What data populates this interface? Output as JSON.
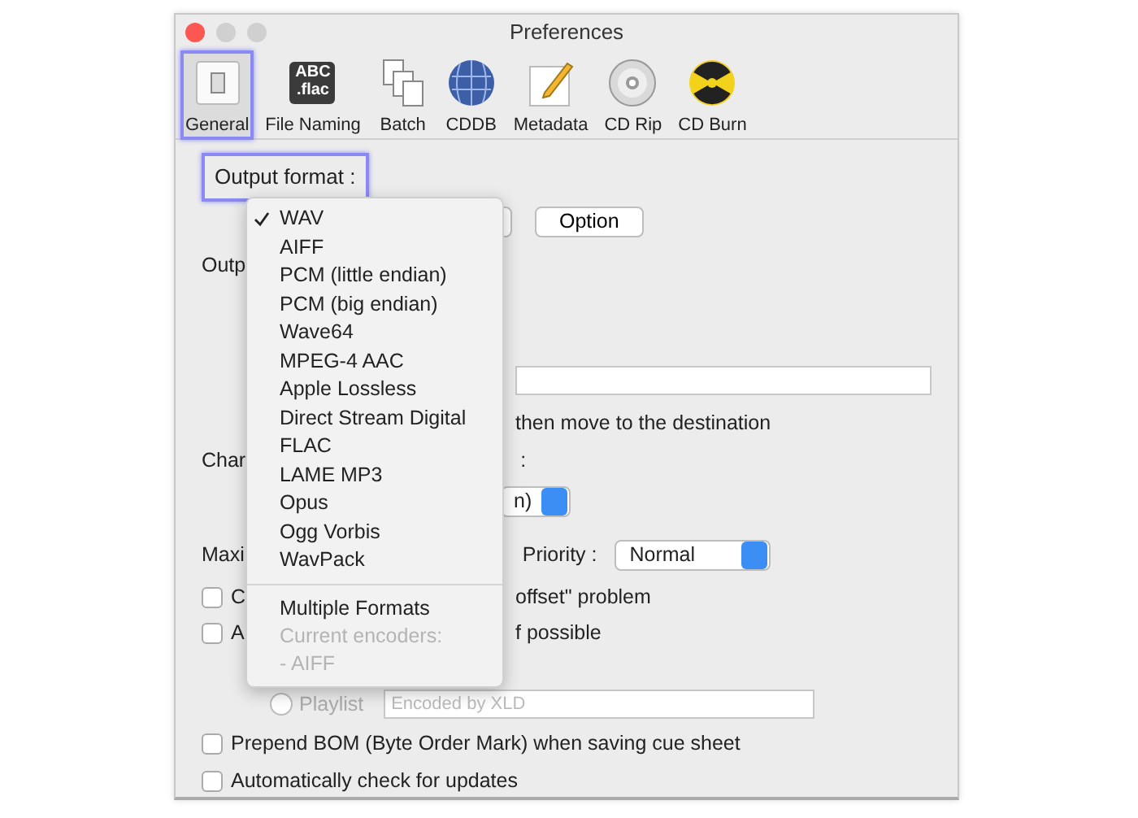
{
  "window": {
    "title": "Preferences"
  },
  "toolbar": [
    {
      "label": "General",
      "kind": "general",
      "selected": true,
      "highlighted": true
    },
    {
      "label": "File Naming",
      "kind": "file-naming",
      "selected": false,
      "highlighted": false,
      "icon_text": [
        "ABC",
        ".flac"
      ]
    },
    {
      "label": "Batch",
      "kind": "batch",
      "selected": false,
      "highlighted": false
    },
    {
      "label": "CDDB",
      "kind": "cddb",
      "selected": false,
      "highlighted": false
    },
    {
      "label": "Metadata",
      "kind": "metadata",
      "selected": false,
      "highlighted": false
    },
    {
      "label": "CD Rip",
      "kind": "cd-rip",
      "selected": false,
      "highlighted": false
    },
    {
      "label": "CD Burn",
      "kind": "cd-burn",
      "selected": false,
      "highlighted": false
    }
  ],
  "output_format": {
    "label": "Output format :",
    "highlighted": true
  },
  "option_button": "Option",
  "format_menu": [
    {
      "label": "WAV",
      "checked": true,
      "disabled": false,
      "separator_before": false
    },
    {
      "label": "AIFF",
      "checked": false,
      "disabled": false,
      "separator_before": false
    },
    {
      "label": "PCM (little endian)",
      "checked": false,
      "disabled": false,
      "separator_before": false
    },
    {
      "label": "PCM (big endian)",
      "checked": false,
      "disabled": false,
      "separator_before": false
    },
    {
      "label": "Wave64",
      "checked": false,
      "disabled": false,
      "separator_before": false
    },
    {
      "label": "MPEG-4 AAC",
      "checked": false,
      "disabled": false,
      "separator_before": false
    },
    {
      "label": "Apple Lossless",
      "checked": false,
      "disabled": false,
      "separator_before": false
    },
    {
      "label": "Direct Stream Digital",
      "checked": false,
      "disabled": false,
      "separator_before": false
    },
    {
      "label": "FLAC",
      "checked": false,
      "disabled": false,
      "separator_before": false
    },
    {
      "label": "LAME MP3",
      "checked": false,
      "disabled": false,
      "separator_before": false
    },
    {
      "label": "Opus",
      "checked": false,
      "disabled": false,
      "separator_before": false
    },
    {
      "label": "Ogg Vorbis",
      "checked": false,
      "disabled": false,
      "separator_before": false
    },
    {
      "label": "WavPack",
      "checked": false,
      "disabled": false,
      "separator_before": false
    },
    {
      "label": "Multiple Formats",
      "checked": false,
      "disabled": false,
      "separator_before": true
    },
    {
      "label": "Current encoders:",
      "checked": false,
      "disabled": true,
      "separator_before": false
    },
    {
      "label": "- AIFF",
      "checked": false,
      "disabled": true,
      "separator_before": false
    }
  ],
  "settings": {
    "output_label": "Outp",
    "move_note": "then move to the destination",
    "char_label": "Char",
    "char_colon": ":",
    "char_popup_value": "n)",
    "max_label": "Maxi",
    "priority_label": "Priority :",
    "priority_value": "Normal",
    "partial_checkboxes": [
      {
        "label_start": "C",
        "label_end": "offset\" problem",
        "checked": false
      },
      {
        "label_start": "A",
        "label_end": "f possible",
        "checked": false
      }
    ],
    "playlist": {
      "label": "Playlist",
      "selected": false,
      "placeholder": "Encoded by XLD"
    },
    "checkboxes": [
      {
        "label": "Prepend BOM (Byte Order Mark) when saving cue sheet",
        "checked": false
      },
      {
        "label": "Automatically check for updates",
        "checked": false
      }
    ]
  }
}
